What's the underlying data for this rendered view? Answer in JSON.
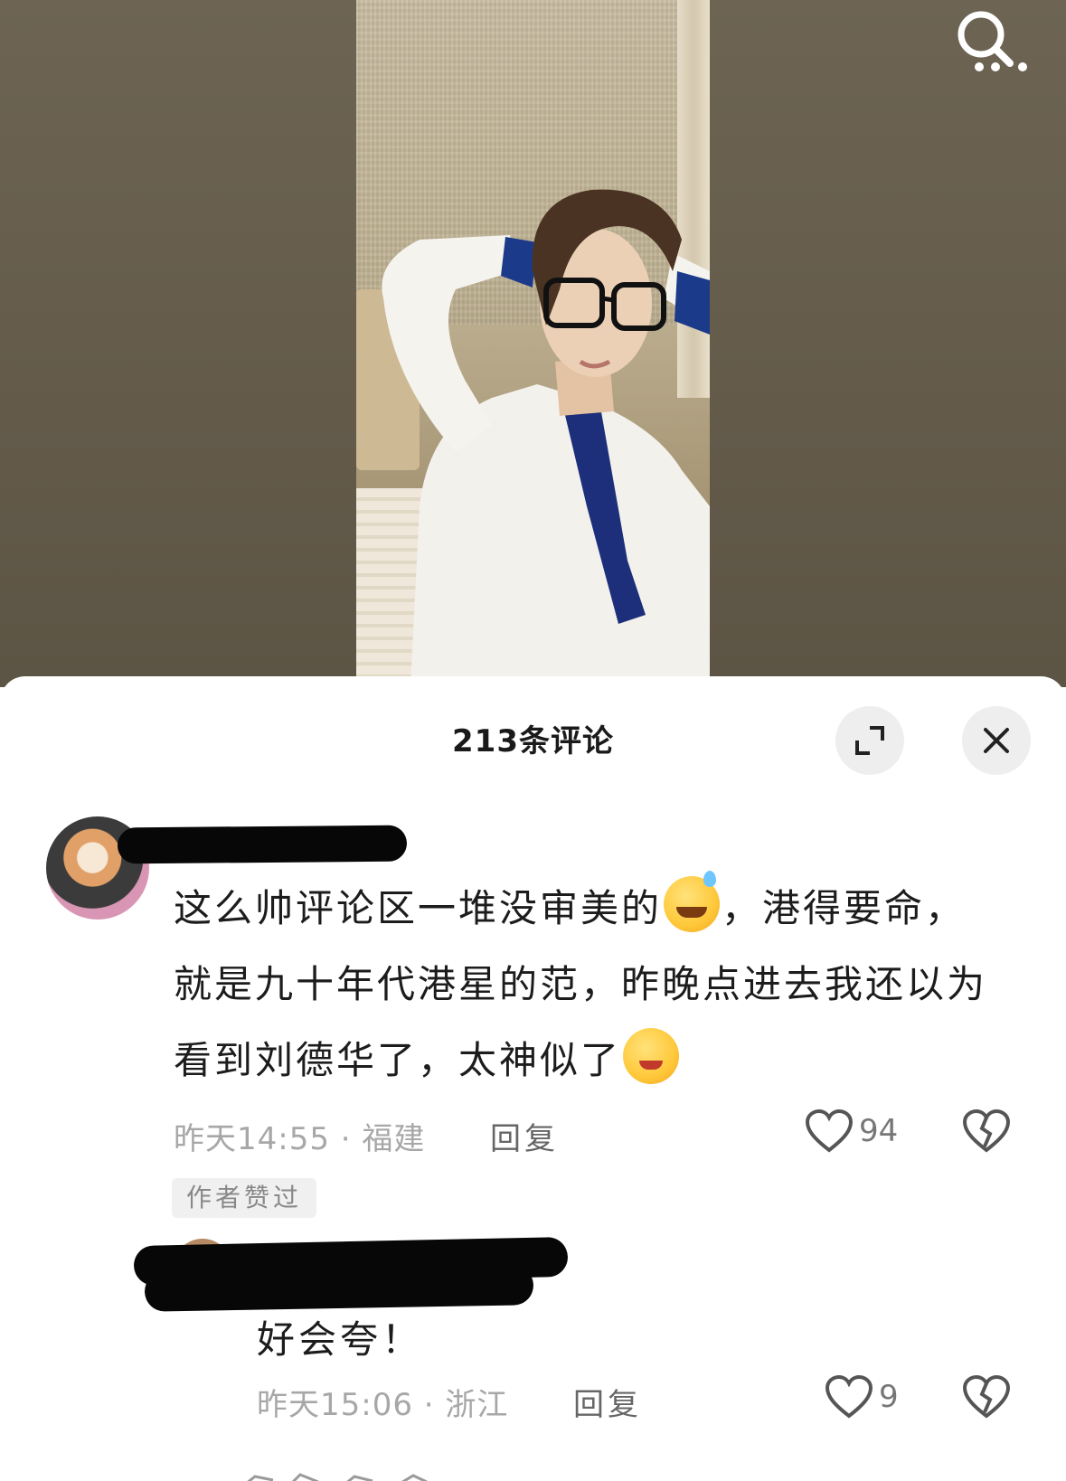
{
  "comments_panel": {
    "title": "213条评论",
    "expand_button_icon": "expand-icon",
    "close_button_icon": "close-icon"
  },
  "top_bar": {
    "search_icon": "search-icon"
  },
  "main_comment": {
    "text_line1": "这么帅评论区一堆没审美的",
    "emoji1": "grinning-sweat-emoji",
    "text_line1b": "，港得要命，",
    "text_line2": "就是九十年代港星的范，昨晚点进去我还以为",
    "text_line3": "看到刘德华了，太神似了",
    "emoji2": "blushing-smile-emoji",
    "time_location": "昨天14:55 · 福建",
    "reply_label": "回复",
    "like_count": "94",
    "author_liked_badge": "作者赞过"
  },
  "reply_comment": {
    "text": "好会夸！",
    "time_location": "昨天15:06 · 浙江",
    "reply_label": "回复",
    "like_count": "9"
  },
  "colors": {
    "sheet_background": "#ffffff",
    "meta_text": "#a7a7a7",
    "redaction": "#070707"
  }
}
